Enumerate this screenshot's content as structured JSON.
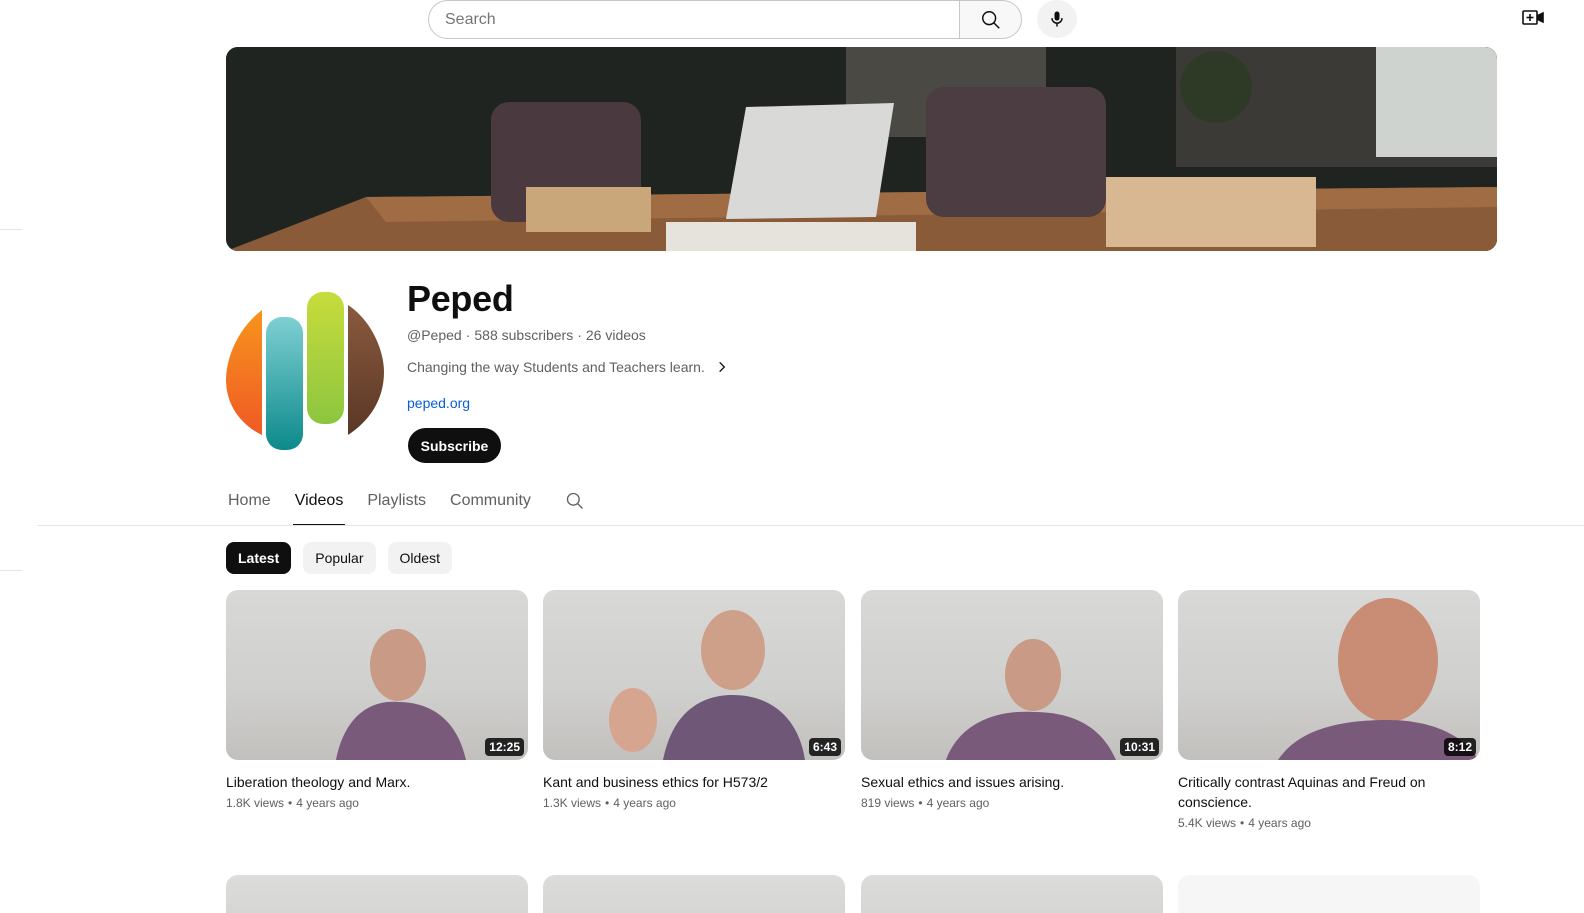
{
  "topbar": {
    "search_placeholder": "Search"
  },
  "channel": {
    "name": "Peped",
    "handle": "@Peped",
    "subscribers": "588 subscribers",
    "videos_count": "26 videos",
    "description": "Changing the way Students and Teachers learn.",
    "link": "peped.org",
    "subscribe_label": "Subscribe"
  },
  "tabs": [
    {
      "label": "Home",
      "active": false
    },
    {
      "label": "Videos",
      "active": true
    },
    {
      "label": "Playlists",
      "active": false
    },
    {
      "label": "Community",
      "active": false
    }
  ],
  "chips": [
    {
      "label": "Latest",
      "active": true
    },
    {
      "label": "Popular",
      "active": false
    },
    {
      "label": "Oldest",
      "active": false
    }
  ],
  "videos": [
    {
      "title": "Liberation theology and Marx.",
      "duration": "12:25",
      "views": "1.8K views",
      "age": "4 years ago"
    },
    {
      "title": "Kant and business ethics for H573/2",
      "duration": "6:43",
      "views": "1.3K views",
      "age": "4 years ago"
    },
    {
      "title": "Sexual ethics and issues arising.",
      "duration": "10:31",
      "views": "819 views",
      "age": "4 years ago"
    },
    {
      "title": "Critically contrast Aquinas and Freud on conscience.",
      "duration": "8:12",
      "views": "5.4K views",
      "age": "4 years ago"
    }
  ],
  "colors": {
    "accent_link": "#065fd4",
    "text_primary": "#0f0f0f",
    "text_secondary": "#606060",
    "chip_bg": "#f2f2f2"
  },
  "icons": {
    "search": "search-icon",
    "mic": "mic-icon",
    "create": "create-video-icon",
    "chevron": "chevron-right-icon",
    "tab_search": "search-icon"
  }
}
